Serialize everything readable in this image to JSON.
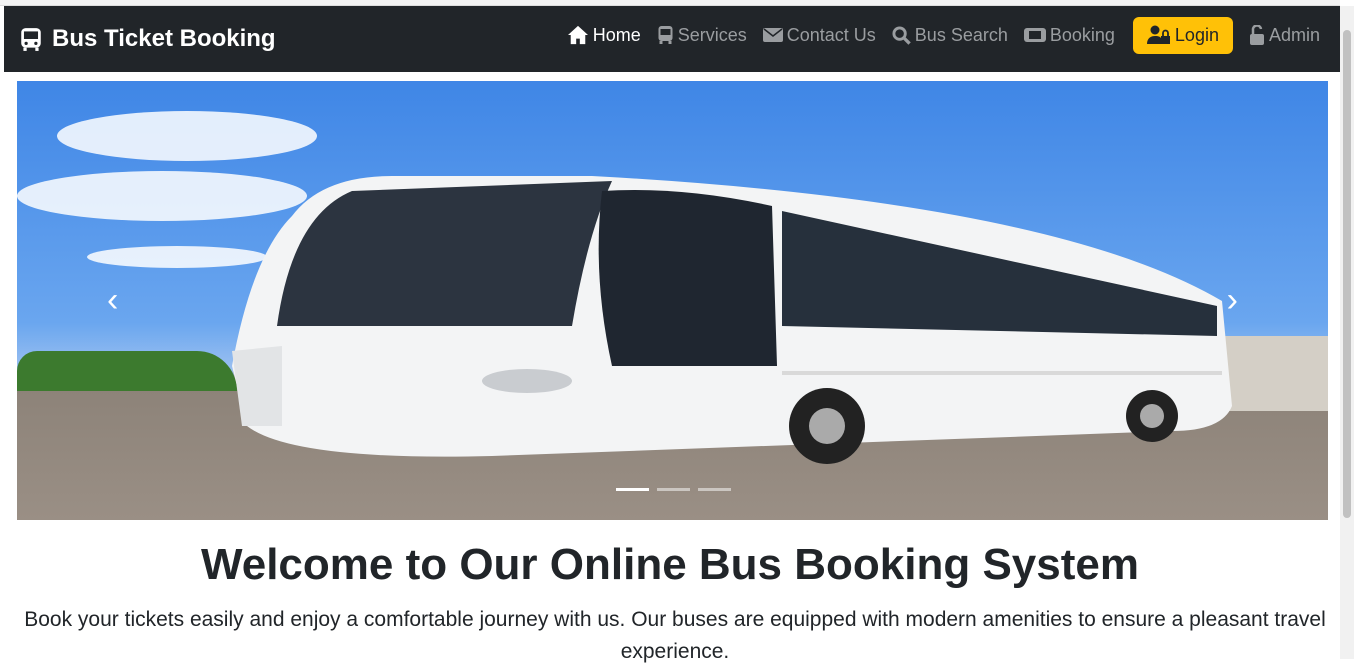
{
  "brand": {
    "title": "Bus Ticket Booking",
    "icon": "bus-icon"
  },
  "nav": {
    "items": [
      {
        "label": "Home",
        "icon": "home-icon",
        "active": true
      },
      {
        "label": "Services",
        "icon": "bus-icon"
      },
      {
        "label": "Contact Us",
        "icon": "envelope-icon"
      },
      {
        "label": "Bus Search",
        "icon": "search-icon"
      },
      {
        "label": "Booking",
        "icon": "ticket-icon"
      }
    ],
    "login": "Login",
    "admin": "Admin"
  },
  "carousel": {
    "slides": 3,
    "active": 1,
    "prev": "‹",
    "next": "›"
  },
  "hero": {
    "title": "Welcome to Our Online Bus Booking System",
    "text": "Book your tickets easily and enjoy a comfortable journey with us. Our buses are equipped with modern amenities to ensure a pleasant travel experience."
  },
  "colors": {
    "navbar": "#212529",
    "accent": "#ffc107"
  }
}
